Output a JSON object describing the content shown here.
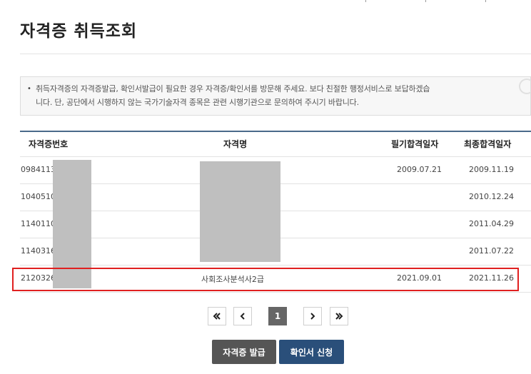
{
  "page": {
    "title": "자격증 취득조회"
  },
  "notice": {
    "bullet": "•",
    "line1": "취득자격증의 자격증발급, 확인서발급이 필요한 경우 자격증/확인서를 방문해 주세요. 보다 친절한 행정서비스로 보답하겠습",
    "line2": "니다. 단, 공단에서 시행하지 않는 국가기술자격 종목은 관련 시행기관으로 문의하여 주시기 바랍니다."
  },
  "table": {
    "headers": {
      "cert_no": "자격증번호",
      "cert_name": "자격명",
      "written_date": "필기합격일자",
      "final_date": "최종합격일자"
    },
    "rows": [
      {
        "cert_no": "0984113",
        "cert_name": "",
        "written_date": "2009.07.21",
        "final_date": "2009.11.19"
      },
      {
        "cert_no": "1040510",
        "cert_name": "",
        "written_date": "",
        "final_date": "2010.12.24"
      },
      {
        "cert_no": "1140110",
        "cert_name": "",
        "written_date": "",
        "final_date": "2011.04.29"
      },
      {
        "cert_no": "1140316",
        "cert_name": "",
        "written_date": "",
        "final_date": "2011.07.22"
      },
      {
        "cert_no": "2120326",
        "cert_name": "사회조사분석사2급",
        "written_date": "2021.09.01",
        "final_date": "2021.11.26"
      }
    ]
  },
  "pagination": {
    "current": "1"
  },
  "buttons": {
    "issue": "자격증 발급",
    "confirm": "확인서 신청"
  },
  "colors": {
    "highlight": "#e02020",
    "issue_button": "#555555",
    "confirm_button": "#2a4f7a",
    "table_border": "#4a6a8a"
  }
}
